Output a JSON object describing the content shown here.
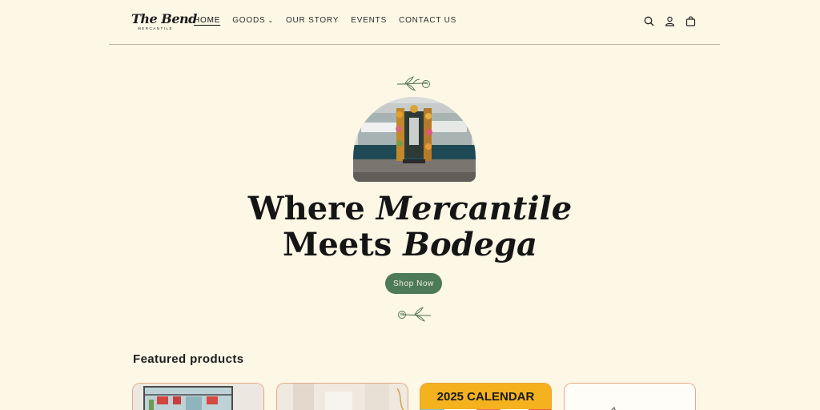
{
  "header": {
    "logo_script": "The Bend",
    "logo_sub": "MERCANTILE",
    "nav": [
      {
        "label": "HOME",
        "active": true
      },
      {
        "label": "GOODS",
        "dropdown": true,
        "chevron": "⌄"
      },
      {
        "label": "OUR STORY"
      },
      {
        "label": "EVENTS"
      },
      {
        "label": "CONTACT US"
      }
    ],
    "icons": [
      "search-icon",
      "account-icon",
      "cart-icon"
    ]
  },
  "hero": {
    "title_line1_plain": "Where ",
    "title_line1_italic": "Mercantile",
    "title_line2_plain": "Meets ",
    "title_line2_italic": "Bodega",
    "button_label": "Shop Now",
    "accent_color": "#4d7a58"
  },
  "featured": {
    "title": "Featured products",
    "products": [
      {
        "image": "stained-glass-window"
      },
      {
        "image": "room-interior"
      },
      {
        "image": "calendar",
        "image_text": "2025 CALENDAR"
      },
      {
        "image": "white-product"
      }
    ]
  },
  "colors": {
    "background": "#fdf7e6",
    "card_border": "#e4a886",
    "calendar_yellow": "#f5b21f"
  }
}
